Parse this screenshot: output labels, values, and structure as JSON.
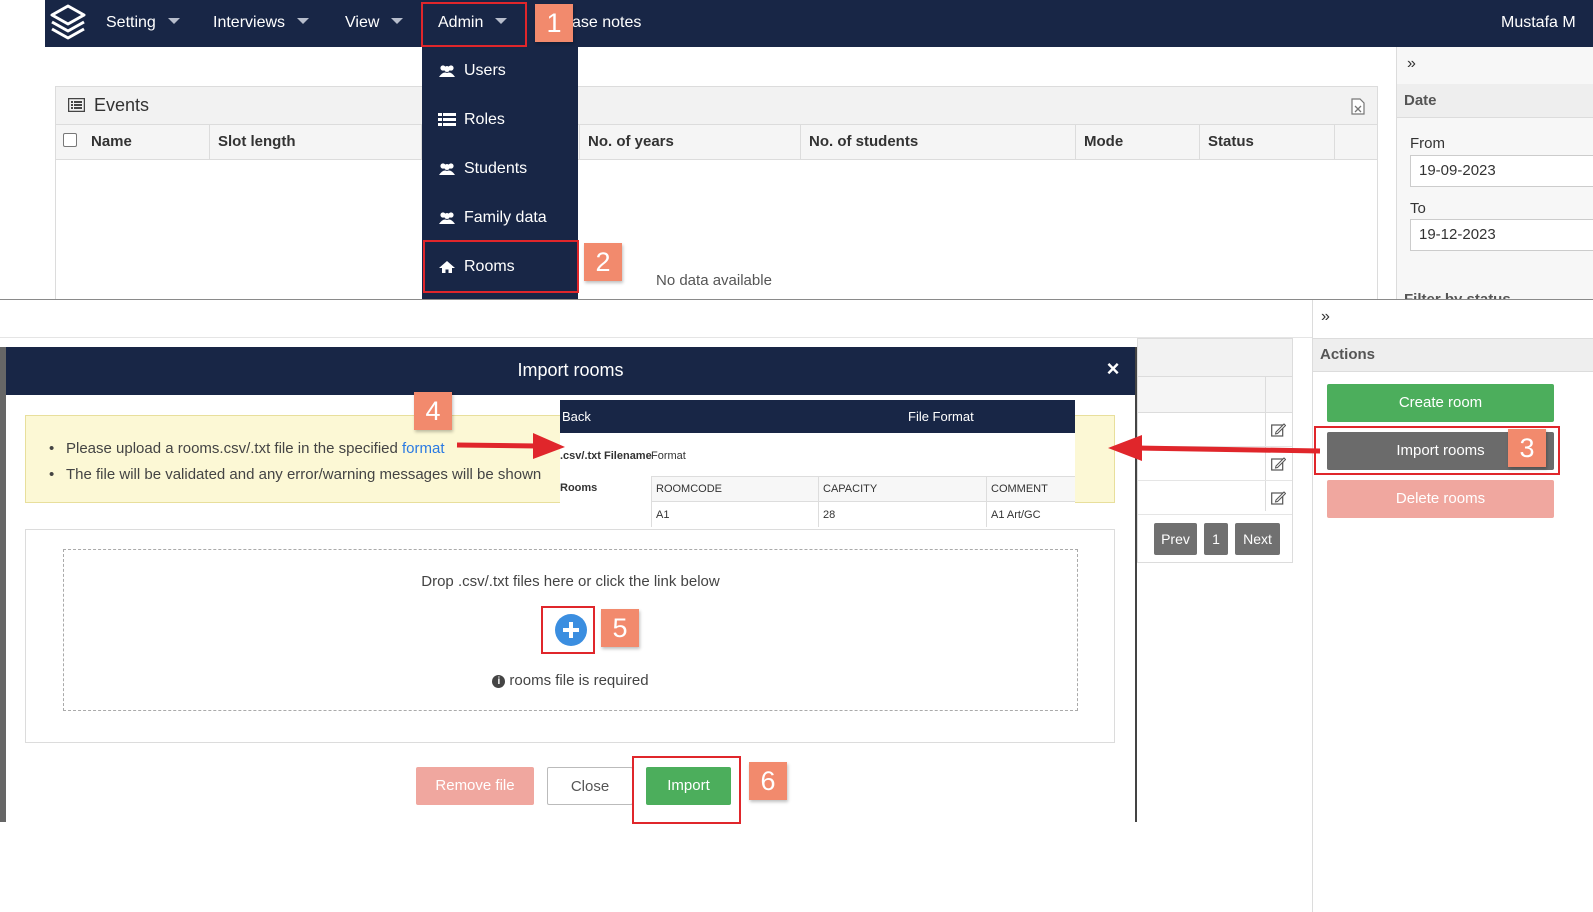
{
  "navbar": {
    "items": [
      "Setting",
      "Interviews",
      "View",
      "Admin"
    ],
    "partial_item": "ase notes",
    "user": "Mustafa M"
  },
  "admin_menu": {
    "items": [
      "Users",
      "Roles",
      "Students",
      "Family data",
      "Rooms"
    ]
  },
  "events": {
    "title": "Events",
    "columns": [
      "Name",
      "Slot length",
      "",
      "No. of years",
      "No. of students",
      "Mode",
      "Status"
    ],
    "empty_text": "No data available"
  },
  "date_filter": {
    "collapse": "»",
    "title": "Date",
    "from_label": "From",
    "from_value": "19-09-2023",
    "to_label": "To",
    "to_value": "19-12-2023",
    "cut_label": "Filter by status"
  },
  "actions": {
    "collapse": "»",
    "title": "Actions",
    "create": "Create room",
    "import": "Import rooms",
    "delete": "Delete rooms",
    "colors": {
      "create": "#4cae5c",
      "import": "#6b6b6b",
      "delete": "#f0a79f"
    }
  },
  "pagination": {
    "prev": "Prev",
    "page": "1",
    "next": "Next"
  },
  "modal": {
    "title": "Import rooms",
    "close": "×",
    "notice_1_prefix": "Please upload a rooms.csv/.txt file in the specified ",
    "notice_1_link": "format",
    "notice_2": "The file will be validated and any error/warning messages will be shown",
    "drop_text": "Drop .csv/.txt files here or click the link below",
    "required_text": "rooms file is required",
    "remove_btn": "Remove file",
    "close_btn": "Close",
    "import_btn": "Import"
  },
  "format_preview": {
    "back": "Back",
    "title": "File Format",
    "filename_label": ".csv/.txt Filename",
    "format_label": "Format",
    "rooms_label": "Rooms",
    "headers": [
      "ROOMCODE",
      "CAPACITY",
      "COMMENT"
    ],
    "row": [
      "A1",
      "28",
      "A1 Art/GC"
    ]
  },
  "annotations": [
    "1",
    "2",
    "3",
    "4",
    "5",
    "6"
  ]
}
